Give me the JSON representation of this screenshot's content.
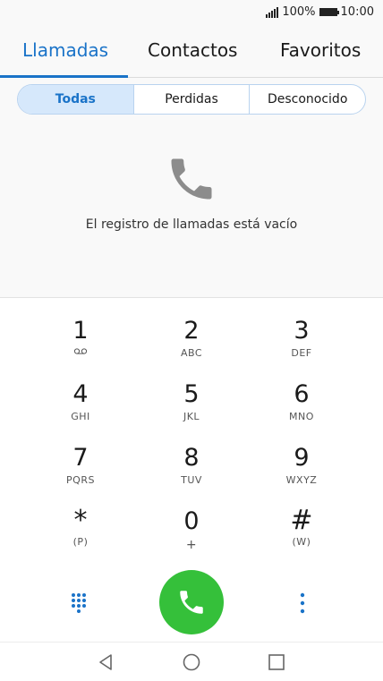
{
  "status_bar": {
    "battery_text": "100%",
    "time": "10:00"
  },
  "tabs": [
    {
      "label": "Llamadas",
      "active": true
    },
    {
      "label": "Contactos",
      "active": false
    },
    {
      "label": "Favoritos",
      "active": false
    }
  ],
  "filters": [
    {
      "label": "Todas",
      "active": true
    },
    {
      "label": "Perdidas",
      "active": false
    },
    {
      "label": "Desconocido",
      "active": false
    }
  ],
  "empty_state": {
    "message": "El registro de llamadas está vacío",
    "icon": "phone-icon"
  },
  "keypad": {
    "keys": [
      {
        "digit": "1",
        "letters": ""
      },
      {
        "digit": "2",
        "letters": "ABC"
      },
      {
        "digit": "3",
        "letters": "DEF"
      },
      {
        "digit": "4",
        "letters": "GHI"
      },
      {
        "digit": "5",
        "letters": "JKL"
      },
      {
        "digit": "6",
        "letters": "MNO"
      },
      {
        "digit": "7",
        "letters": "PQRS"
      },
      {
        "digit": "8",
        "letters": "TUV"
      },
      {
        "digit": "9",
        "letters": "WXYZ"
      },
      {
        "digit": "*",
        "letters": "(P)"
      },
      {
        "digit": "0",
        "letters": "+"
      },
      {
        "digit": "#",
        "letters": "(W)"
      }
    ]
  },
  "colors": {
    "accent": "#1a73c8",
    "call_green": "#35c03a"
  }
}
